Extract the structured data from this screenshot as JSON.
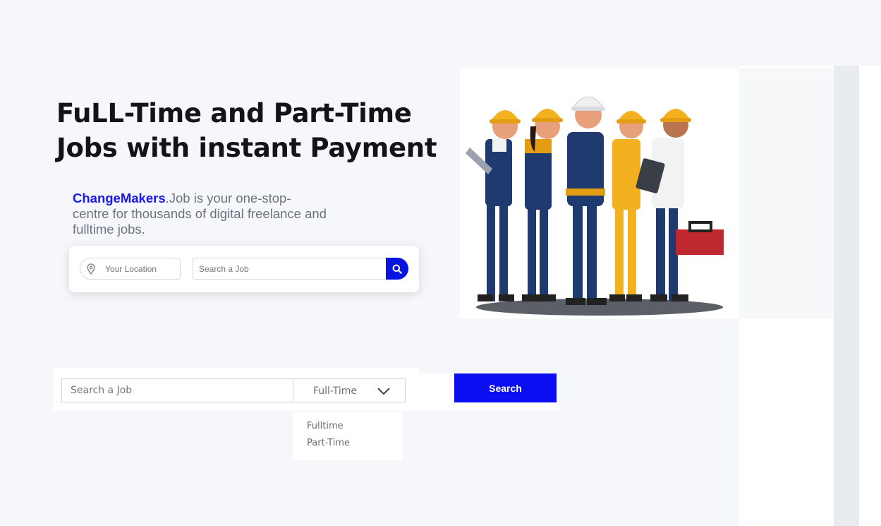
{
  "hero": {
    "headline_line1": "FuLL-Time and Part-Time",
    "headline_line2": "Jobs with instant Payment",
    "brand": "ChangeMakers",
    "tagline": ".Job is your one-stop-centre for thousands of digital freelance and fulltime jobs."
  },
  "search_card": {
    "location_placeholder": "Your Location",
    "job_placeholder": "Search a Job",
    "location_icon": "map-pin-icon",
    "search_icon": "search-icon"
  },
  "illustration": {
    "icon": "construction-workers-illustration"
  },
  "filter": {
    "job_placeholder": "Search a Job",
    "selected": "Full-Time",
    "chevron_icon": "chevron-down-icon",
    "options": [
      "Fulltime",
      "Part-Time"
    ],
    "search_label": "Search"
  },
  "colors": {
    "accent": "#0a0ef0",
    "brand": "#1a1ae6",
    "headline": "#111418",
    "helmet": "#f3b11f"
  }
}
